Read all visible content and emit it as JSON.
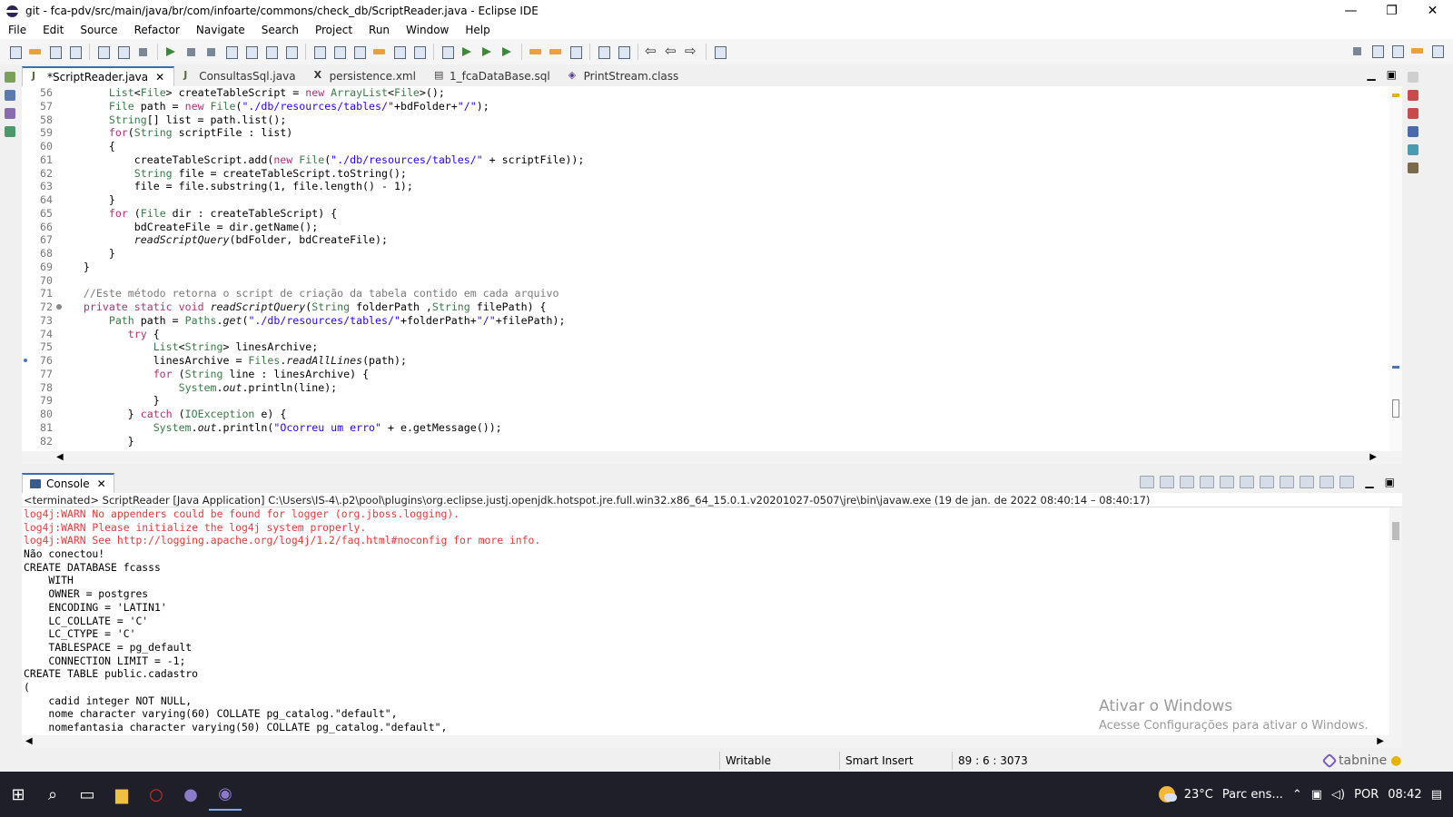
{
  "window": {
    "title": "git - fca-pdv/src/main/java/br/com/infoarte/commons/check_db/ScriptReader.java - Eclipse IDE",
    "min": "—",
    "max": "❐",
    "close": "✕"
  },
  "menu": [
    "File",
    "Edit",
    "Source",
    "Refactor",
    "Navigate",
    "Search",
    "Project",
    "Run",
    "Window",
    "Help"
  ],
  "editor_tabs": [
    {
      "label": "*ScriptReader.java",
      "icon": "java-file-icon",
      "active": true,
      "close": "✕"
    },
    {
      "label": "ConsultasSql.java",
      "icon": "java-file-icon",
      "active": false
    },
    {
      "label": "persistence.xml",
      "icon": "xml-file-icon",
      "active": false
    },
    {
      "label": "1_fcaDataBase.sql",
      "icon": "sql-file-icon",
      "active": false
    },
    {
      "label": "PrintStream.class",
      "icon": "class-file-icon",
      "active": false
    }
  ],
  "editor": {
    "line_numbers": [
      "56",
      "57",
      "58",
      "59",
      "60",
      "61",
      "62",
      "63",
      "64",
      "65",
      "66",
      "67",
      "68",
      "69",
      "70",
      "71",
      "72",
      "73",
      "74",
      "75",
      "76",
      "77",
      "78",
      "79",
      "80",
      "81",
      "82"
    ],
    "code_lines": [
      "        List<File> createTableScript = new ArrayList<File>();",
      "        File path = new File(\"./db/resources/tables/\"+bdFolder+\"/\");",
      "        String[] list = path.list();",
      "        for(String scriptFile : list)",
      "        {",
      "            createTableScript.add(new File(\"./db/resources/tables/\" + scriptFile));",
      "            String file = createTableScript.toString();",
      "            file = file.substring(1, file.length() - 1);",
      "        }",
      "        for (File dir : createTableScript) {",
      "            bdCreateFile = dir.getName();",
      "            readScriptQuery(bdFolder, bdCreateFile);",
      "        }",
      "    }",
      "",
      "    //Este método retorna o script de criação da tabela contido em cada arquivo",
      "    private static void readScriptQuery(String folderPath ,String filePath) {",
      "        Path path = Paths.get(\"./db/resources/tables/\"+folderPath+\"/\"+filePath);",
      "           try {",
      "               List<String> linesArchive;",
      "               linesArchive = Files.readAllLines(path);",
      "               for (String line : linesArchive) {",
      "                   System.out.println(line);",
      "               }",
      "           } catch (IOException e) {",
      "               System.out.println(\"Ocorreu um erro\" + e.getMessage());",
      "           }"
    ]
  },
  "console": {
    "tab_label": "Console",
    "tab_close": "✕",
    "terminated": "<terminated> ScriptReader [Java Application] C:\\Users\\IS-4\\.p2\\pool\\plugins\\org.eclipse.justj.openjdk.hotspot.jre.full.win32.x86_64_15.0.1.v20201027-0507\\jre\\bin\\javaw.exe  (19 de jan. de 2022 08:40:14 – 08:40:17)",
    "lines": [
      {
        "text": "log4j:WARN No appenders could be found for logger (org.jboss.logging).",
        "err": true
      },
      {
        "text": "log4j:WARN Please initialize the log4j system properly.",
        "err": true
      },
      {
        "text": "log4j:WARN See http://logging.apache.org/log4j/1.2/faq.html#noconfig for more info.",
        "err": true
      },
      {
        "text": "Não conectou!",
        "err": false
      },
      {
        "text": "CREATE DATABASE fcasss",
        "err": false
      },
      {
        "text": "    WITH",
        "err": false
      },
      {
        "text": "    OWNER = postgres",
        "err": false
      },
      {
        "text": "    ENCODING = 'LATIN1'",
        "err": false
      },
      {
        "text": "    LC_COLLATE = 'C'",
        "err": false
      },
      {
        "text": "    LC_CTYPE = 'C'",
        "err": false
      },
      {
        "text": "    TABLESPACE = pg_default",
        "err": false
      },
      {
        "text": "    CONNECTION LIMIT = -1;",
        "err": false
      },
      {
        "text": "CREATE TABLE public.cadastro",
        "err": false
      },
      {
        "text": "(",
        "err": false
      },
      {
        "text": "    cadid integer NOT NULL,",
        "err": false
      },
      {
        "text": "    nome character varying(60) COLLATE pg_catalog.\"default\",",
        "err": false
      },
      {
        "text": "    nomefantasia character varying(50) COLLATE pg_catalog.\"default\",",
        "err": false
      }
    ]
  },
  "watermark": {
    "title": "Ativar o Windows",
    "subtitle": "Acesse Configurações para ativar o Windows."
  },
  "status": {
    "writable": "Writable",
    "insert_mode": "Smart Insert",
    "position": "89 : 6 : 3073",
    "tabnine": "tabnine"
  },
  "taskbar": {
    "temperature": "23°C",
    "weather_text": "Parc ens...",
    "language": "POR",
    "time": "08:42"
  },
  "colors": {
    "keyword": "#b42e7a",
    "string": "#2a00ff",
    "comment": "#7a7a7a",
    "error": "#e23b3b",
    "active_tab": "#3a6fb0"
  }
}
